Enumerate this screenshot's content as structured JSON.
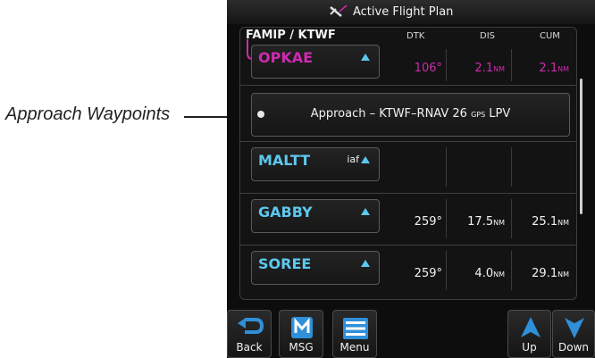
{
  "callout": {
    "label": "Approach Waypoints"
  },
  "titlebar": {
    "title": "Active Flight Plan",
    "icon": "airplane-track-icon"
  },
  "flight_plan": {
    "route": "FAMIP / KTWF",
    "columns": {
      "dtk": "DTK",
      "dis": "DIS",
      "cum": "CUM"
    },
    "unit": "NM",
    "active_waypoint": {
      "name": "OPKAE",
      "dtk": "106°",
      "dis": "2.1",
      "cum": "2.1"
    },
    "approach": {
      "prefix": "Approach – KTWF–RNAV 26 ",
      "gps": "GPS",
      "suffix": " LPV"
    },
    "waypoints": [
      {
        "name": "MALTT",
        "tag": "iaf",
        "dtk": "",
        "dis": "",
        "cum": ""
      },
      {
        "name": "GABBY",
        "tag": "",
        "dtk": "259°",
        "dis": "17.5",
        "cum": "25.1"
      },
      {
        "name": "SOREE",
        "tag": "",
        "dtk": "259°",
        "dis": "4.0",
        "cum": "29.1"
      }
    ]
  },
  "buttons": {
    "back": "Back",
    "msg": "MSG",
    "menu": "Menu",
    "up": "Up",
    "down": "Down"
  },
  "colors": {
    "active": "#d02ab0",
    "waypoint": "#5cc8ee",
    "accent": "#2f8fd8"
  }
}
